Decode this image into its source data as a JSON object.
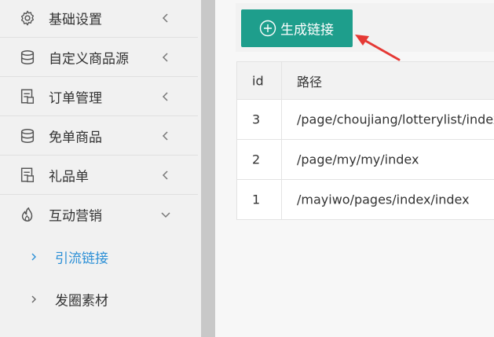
{
  "sidebar": {
    "items": [
      {
        "label": "基础设置",
        "icon": "gear-icon"
      },
      {
        "label": "自定义商品源",
        "icon": "database-icon"
      },
      {
        "label": "订单管理",
        "icon": "document-icon"
      },
      {
        "label": "免单商品",
        "icon": "database-icon"
      },
      {
        "label": "礼品单",
        "icon": "document-icon"
      },
      {
        "label": "互动营销",
        "icon": "flame-icon"
      }
    ],
    "sub_items": [
      {
        "label": "引流链接",
        "active": true
      },
      {
        "label": "发圈素材",
        "active": false
      }
    ]
  },
  "toolbar": {
    "generate_label": "生成链接"
  },
  "table": {
    "headers": [
      "id",
      "路径"
    ],
    "rows": [
      {
        "id": "3",
        "path": "/page/choujiang/lotterylist/index"
      },
      {
        "id": "2",
        "path": "/page/my/my/index"
      },
      {
        "id": "1",
        "path": "/mayiwo/pages/index/index"
      }
    ]
  },
  "colors": {
    "accent": "#1e9e8c",
    "active_link": "#2b8fd6",
    "annotation": "#e53935"
  }
}
